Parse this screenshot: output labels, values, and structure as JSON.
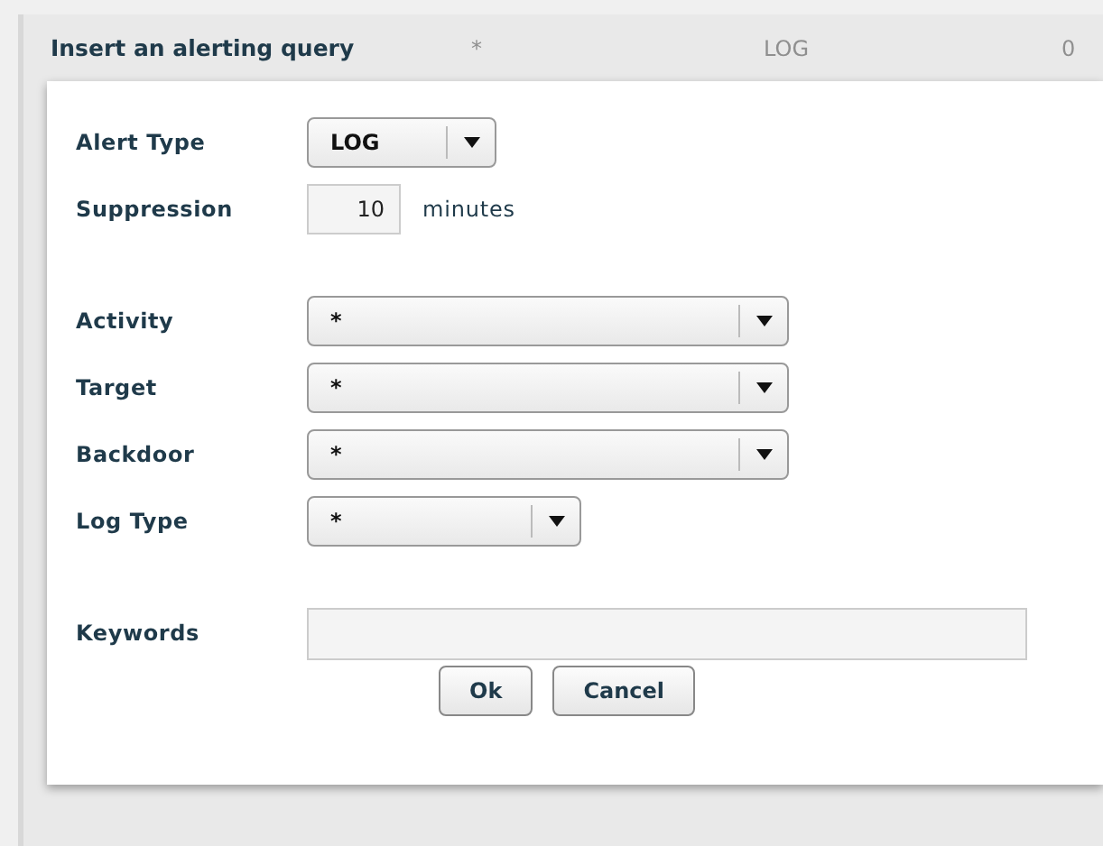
{
  "background": {
    "cells": [
      "*",
      "LOG",
      "0"
    ]
  },
  "dialog": {
    "title": "Insert an alerting query",
    "fields": [
      {
        "kind": "short-select",
        "label": "Alert Type",
        "value": "LOG"
      },
      {
        "kind": "number",
        "label": "Suppression",
        "value": "10",
        "unit": "minutes"
      },
      {
        "kind": "spacer"
      },
      {
        "kind": "wide-select",
        "label": "Activity",
        "value": "*"
      },
      {
        "kind": "wide-select",
        "label": "Target",
        "value": "*"
      },
      {
        "kind": "wide-select",
        "label": "Backdoor",
        "value": "*"
      },
      {
        "kind": "medium-select",
        "label": "Log Type",
        "value": "*"
      },
      {
        "kind": "spacer"
      },
      {
        "kind": "text",
        "label": "Keywords"
      }
    ],
    "buttons": [
      "Ok",
      "Cancel"
    ]
  }
}
